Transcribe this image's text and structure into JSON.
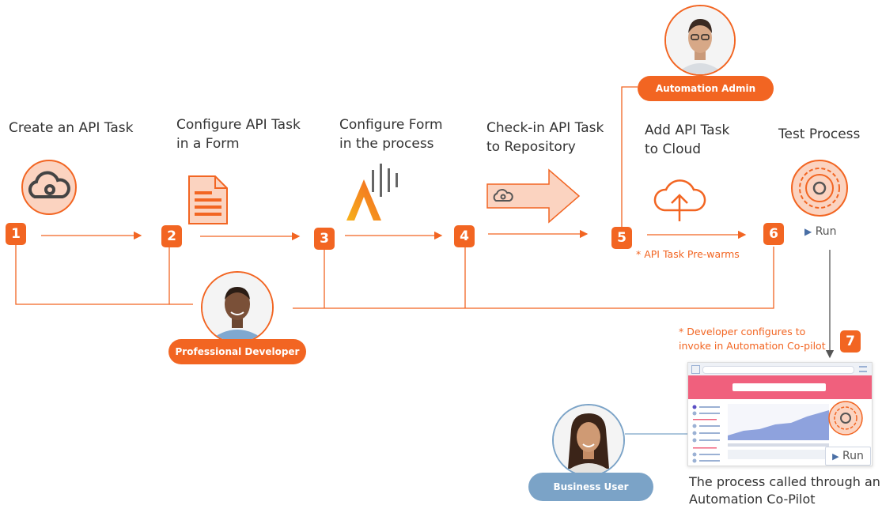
{
  "steps": [
    {
      "number": "1",
      "title": "Create an API Task",
      "icon": "cloud-api-icon"
    },
    {
      "number": "2",
      "title": "Configure API Task\nin a Form",
      "icon": "document-icon"
    },
    {
      "number": "3",
      "title": "Configure Form\nin the process",
      "icon": "automation-anywhere-logo-icon"
    },
    {
      "number": "4",
      "title": "Check-in API Task\nto Repository",
      "icon": "arrow-checkin-icon"
    },
    {
      "number": "5",
      "title": "Add API Task\nto Cloud",
      "icon": "cloud-upload-icon"
    },
    {
      "number": "6",
      "title": "Test Process",
      "icon": "gear-process-icon"
    },
    {
      "number": "7",
      "title": "",
      "icon": ""
    }
  ],
  "roles": {
    "admin": "Automation Admin",
    "developer": "Professional Developer",
    "business_user": "Business User"
  },
  "notes": {
    "prewarm": "* API Task Pre-warms",
    "copilot_config": "* Developer configures to\ninvoke in Automation Co-pilot"
  },
  "run_label": "Run",
  "screen_run_label": "Run",
  "caption": "The process called through an\nAutomation Co-Pilot",
  "colors": {
    "accent": "#f26522",
    "business_user_pill": "#7ba3c7",
    "screen_header": "#f0607d"
  }
}
